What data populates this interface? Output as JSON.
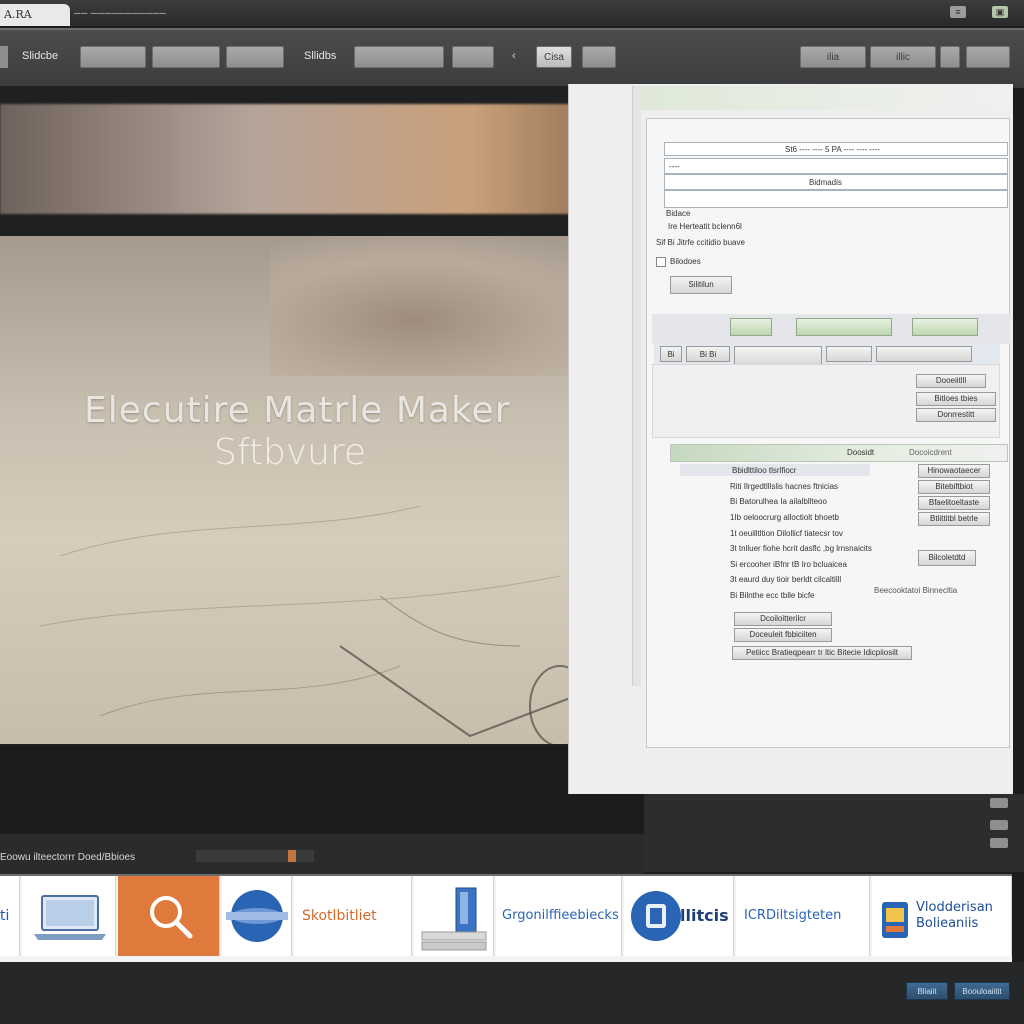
{
  "window": {
    "logo_text": "A.RA",
    "title": "── ───────────",
    "controls": [
      "≡",
      "▣"
    ]
  },
  "toolbar": {
    "label_left": "Slidcbe",
    "label_mid": "Sllidbs",
    "buttons": [
      "",
      "",
      "",
      "",
      "",
      "",
      "Cisa"
    ],
    "right_buttons": [
      "ilia",
      "illic",
      "",
      ""
    ]
  },
  "preview": {
    "headline": "Elecutire Matrle Maker",
    "subheadline": "Sftbvure"
  },
  "settings_panel": {
    "row1": "St6 ---- ---- 5 PA  ---- ---- ----",
    "row2": "----",
    "row3": "Bidmadis",
    "label1": "Bidace",
    "line1": "Ire Herteatit bclenn6l",
    "line2": "Sif Bi Jitrfe ccitidio buave",
    "checkbox_label": "Bilodoes",
    "button1": "Silitilun",
    "green_buttons": [
      "",
      "",
      ""
    ],
    "tab_labels": [
      "Bi",
      "Bi Bi",
      "",
      "",
      "",
      ""
    ],
    "side_buttons": [
      "Dooeiitlll",
      "Bitloes tbies",
      "Donrrestitt"
    ],
    "section_title": "Doosidt",
    "section_title2": "Docoicdrent",
    "list": [
      "Bbidlttiloo tlsrlfiocr",
      "Riti Ilrgedtlllslis hacnes ftnicias",
      "Bi Batorulhea Ia ailalbllteoo",
      "1Ib oeloocrurg alloctiolt bhoetb",
      "1t oeuilltltion Dilollicf tiatecsr tov",
      "3t tnlluer fiohe hcrit dasflc ,bg lrnsnaicits",
      "Si ercooher iBfnr tB Iro bcluaicea",
      "3t eaurd duy tioir berldt cilcaltilll",
      "Bi Bilnthe ecc tblle bicfe"
    ],
    "right_list": [
      "Hinowaotaecer",
      "Bitebiftbiot",
      "Bfaelitoeltaste",
      "Btlittitbl betrle"
    ],
    "small_button": "Bilcoletdtd",
    "note": "Beecooktatoi Binnecltia",
    "bottom_buttons": [
      "Dcoiloitterilcr",
      "Doceuleit fbbiciiten"
    ],
    "bottom_row": "Petiicc Bratieqpearr tr ltic Bitecie Idicpiiosilt"
  },
  "status": {
    "text": "Eoowu ilteectorrr Doed/Bbioes"
  },
  "icon_strip": {
    "tiles": [
      {
        "icon": "partial-icon",
        "text": "ti"
      },
      {
        "icon": "laptop-icon",
        "text": ""
      },
      {
        "icon": "search-icon",
        "text": ""
      },
      {
        "icon": "globe-badge-icon",
        "text": ""
      },
      {
        "icon": "",
        "text": "Skotlbitliet"
      },
      {
        "icon": "server-icon",
        "text": ""
      },
      {
        "icon": "",
        "text": "Grgonilffieebiecks"
      },
      {
        "icon": "shield-badge-icon",
        "text": "llitcis"
      },
      {
        "icon": "",
        "text": "ICRDiltsigteten"
      },
      {
        "icon": "app-icon",
        "text": "Vlodderisan Bolieaniis"
      }
    ],
    "accent": "#e07a3c",
    "blue": "#2a64b4"
  },
  "bottom_bar": {
    "buttons": [
      "Bliaiit",
      "Boouloaiitit"
    ]
  }
}
